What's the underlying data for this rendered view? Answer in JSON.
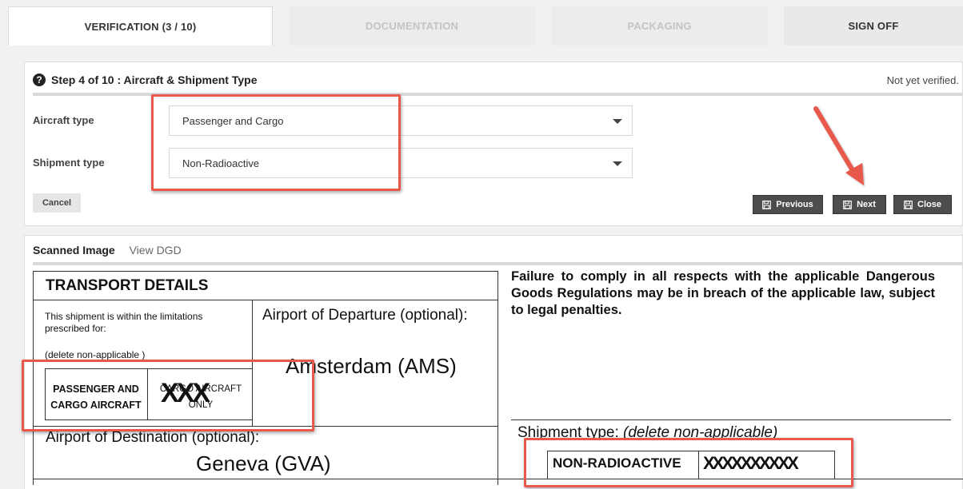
{
  "tabs": [
    {
      "label": "VERIFICATION (3 / 10)",
      "active": true
    },
    {
      "label": "DOCUMENTATION",
      "active": false
    },
    {
      "label": "PACKAGING",
      "active": false
    },
    {
      "label": "SIGN OFF",
      "active": false
    }
  ],
  "step": {
    "title": "Step 4 of 10 : Aircraft & Shipment Type",
    "status": "Not yet verified."
  },
  "fields": {
    "aircraft_label": "Aircraft type",
    "aircraft_value": "Passenger and Cargo",
    "shipment_label": "Shipment type",
    "shipment_value": "Non-Radioactive"
  },
  "buttons": {
    "cancel": "Cancel",
    "previous": "Previous",
    "next": "Next",
    "close": "Close"
  },
  "image_panel": {
    "tab_scanned": "Scanned Image",
    "tab_dgd": "View DGD"
  },
  "document": {
    "heading": "TRANSPORT DETAILS",
    "limits_text": "This shipment is within the limitations prescribed for:",
    "delete_note": "(delete non-applicable )",
    "pax_cargo": "PASSENGER AND CARGO AIRCRAFT",
    "cargo_only": "CARGO AIRCRAFT ONLY",
    "cross_mark": "XXX",
    "departure_label": "Airport of Departure (optional):",
    "departure_value": "Amsterdam (AMS)",
    "destination_label": "Airport of Destination (optional):",
    "destination_value": "Geneva (GVA)",
    "warning": "Failure to comply in all respects with the applicable Dangerous Goods Regulations may be in breach of the applicable law, subject to legal penalties.",
    "shipment_type_label": "Shipment type:",
    "shipment_type_note": "(delete non-applicable)",
    "non_radioactive": "NON-RADIOACTIVE",
    "radioactive_crossed": "XXXXXXXXXX"
  },
  "colors": {
    "highlight": "#e8584b",
    "button_dark": "#4d4d4d"
  },
  "icons": [
    "question-circle-icon",
    "chevron-down-icon",
    "save-icon",
    "arrow-annotation-icon"
  ]
}
